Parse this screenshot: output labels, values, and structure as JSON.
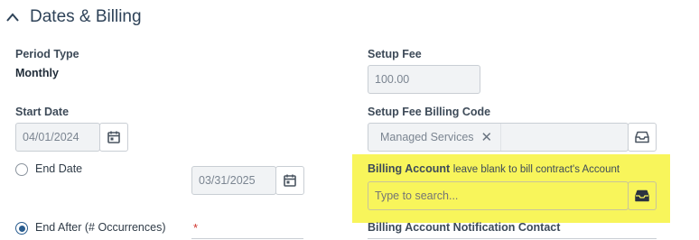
{
  "section": {
    "title": "Dates & Billing"
  },
  "period_type": {
    "label": "Period Type",
    "value": "Monthly"
  },
  "setup_fee": {
    "label": "Setup Fee",
    "value": "100.00"
  },
  "start_date": {
    "label": "Start Date",
    "value": "04/01/2024"
  },
  "setup_fee_billing_code": {
    "label": "Setup Fee Billing Code",
    "tag": "Managed Services",
    "tag_remove": "✕"
  },
  "end_date": {
    "label": "End Date",
    "value": "03/31/2025",
    "selected": false
  },
  "billing_account": {
    "label": "Billing Account",
    "hint": "leave blank to bill contract's Account",
    "placeholder": "Type to search...",
    "highlight_color": "#f8f55b"
  },
  "end_after": {
    "label": "End After (# Occurrences)",
    "required_mark": "*",
    "selected": true
  },
  "billing_account_notification_contact": {
    "label": "Billing Account Notification Contact"
  },
  "icons": {
    "collapse": "chevron-up-icon",
    "calendar": "calendar-icon",
    "lookup": "inbox-tray-icon"
  }
}
